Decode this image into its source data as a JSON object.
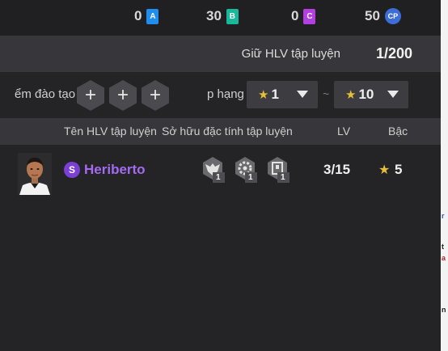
{
  "currency": [
    {
      "amount": "0",
      "icon": "A",
      "color": "#1f8ef0"
    },
    {
      "amount": "30",
      "icon": "B",
      "color": "#19b89b"
    },
    {
      "amount": "0",
      "icon": "C",
      "color": "#b43fe0"
    },
    {
      "amount": "50",
      "icon": "CP",
      "color": "#3d6ed8"
    }
  ],
  "hold": {
    "label": "Giữ HLV tập luyện",
    "value": "1/200"
  },
  "filters": {
    "training_slots_label": "ểm đào tạo",
    "add_symbol": "+",
    "rank_label": "p hạng",
    "rank_from": "1",
    "rank_to": "10",
    "range_sep": "~",
    "star": "★"
  },
  "table": {
    "headers": {
      "name": "Tên HLV tập luyện",
      "traits": "Sở hữu đặc tính tập luyện",
      "lv": "LV",
      "grade": "Bậc"
    },
    "rows": [
      {
        "badge": "S",
        "name": "Heriberto",
        "trait_levels": [
          "1",
          "1",
          "1"
        ],
        "lv": "3/15",
        "grade": "5"
      }
    ]
  },
  "side_fragments": [
    "r",
    "t",
    "a",
    "n"
  ]
}
